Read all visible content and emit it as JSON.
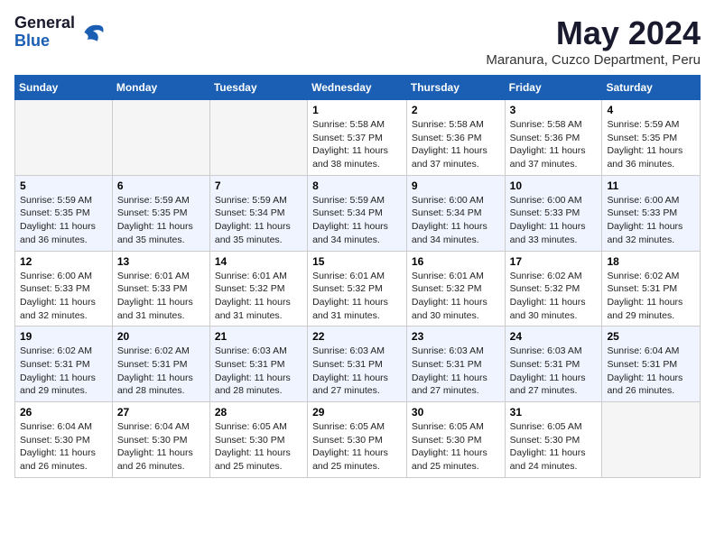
{
  "header": {
    "logo_general": "General",
    "logo_blue": "Blue",
    "main_title": "May 2024",
    "subtitle": "Maranura, Cuzco Department, Peru"
  },
  "days_of_week": [
    "Sunday",
    "Monday",
    "Tuesday",
    "Wednesday",
    "Thursday",
    "Friday",
    "Saturday"
  ],
  "weeks": [
    [
      {
        "day": "",
        "empty": true
      },
      {
        "day": "",
        "empty": true
      },
      {
        "day": "",
        "empty": true
      },
      {
        "day": "1",
        "sunrise": "5:58 AM",
        "sunset": "5:37 PM",
        "daylight": "11 hours and 38 minutes."
      },
      {
        "day": "2",
        "sunrise": "5:58 AM",
        "sunset": "5:36 PM",
        "daylight": "11 hours and 37 minutes."
      },
      {
        "day": "3",
        "sunrise": "5:58 AM",
        "sunset": "5:36 PM",
        "daylight": "11 hours and 37 minutes."
      },
      {
        "day": "4",
        "sunrise": "5:59 AM",
        "sunset": "5:35 PM",
        "daylight": "11 hours and 36 minutes."
      }
    ],
    [
      {
        "day": "5",
        "sunrise": "5:59 AM",
        "sunset": "5:35 PM",
        "daylight": "11 hours and 36 minutes."
      },
      {
        "day": "6",
        "sunrise": "5:59 AM",
        "sunset": "5:35 PM",
        "daylight": "11 hours and 35 minutes."
      },
      {
        "day": "7",
        "sunrise": "5:59 AM",
        "sunset": "5:34 PM",
        "daylight": "11 hours and 35 minutes."
      },
      {
        "day": "8",
        "sunrise": "5:59 AM",
        "sunset": "5:34 PM",
        "daylight": "11 hours and 34 minutes."
      },
      {
        "day": "9",
        "sunrise": "6:00 AM",
        "sunset": "5:34 PM",
        "daylight": "11 hours and 34 minutes."
      },
      {
        "day": "10",
        "sunrise": "6:00 AM",
        "sunset": "5:33 PM",
        "daylight": "11 hours and 33 minutes."
      },
      {
        "day": "11",
        "sunrise": "6:00 AM",
        "sunset": "5:33 PM",
        "daylight": "11 hours and 32 minutes."
      }
    ],
    [
      {
        "day": "12",
        "sunrise": "6:00 AM",
        "sunset": "5:33 PM",
        "daylight": "11 hours and 32 minutes."
      },
      {
        "day": "13",
        "sunrise": "6:01 AM",
        "sunset": "5:33 PM",
        "daylight": "11 hours and 31 minutes."
      },
      {
        "day": "14",
        "sunrise": "6:01 AM",
        "sunset": "5:32 PM",
        "daylight": "11 hours and 31 minutes."
      },
      {
        "day": "15",
        "sunrise": "6:01 AM",
        "sunset": "5:32 PM",
        "daylight": "11 hours and 31 minutes."
      },
      {
        "day": "16",
        "sunrise": "6:01 AM",
        "sunset": "5:32 PM",
        "daylight": "11 hours and 30 minutes."
      },
      {
        "day": "17",
        "sunrise": "6:02 AM",
        "sunset": "5:32 PM",
        "daylight": "11 hours and 30 minutes."
      },
      {
        "day": "18",
        "sunrise": "6:02 AM",
        "sunset": "5:31 PM",
        "daylight": "11 hours and 29 minutes."
      }
    ],
    [
      {
        "day": "19",
        "sunrise": "6:02 AM",
        "sunset": "5:31 PM",
        "daylight": "11 hours and 29 minutes."
      },
      {
        "day": "20",
        "sunrise": "6:02 AM",
        "sunset": "5:31 PM",
        "daylight": "11 hours and 28 minutes."
      },
      {
        "day": "21",
        "sunrise": "6:03 AM",
        "sunset": "5:31 PM",
        "daylight": "11 hours and 28 minutes."
      },
      {
        "day": "22",
        "sunrise": "6:03 AM",
        "sunset": "5:31 PM",
        "daylight": "11 hours and 27 minutes."
      },
      {
        "day": "23",
        "sunrise": "6:03 AM",
        "sunset": "5:31 PM",
        "daylight": "11 hours and 27 minutes."
      },
      {
        "day": "24",
        "sunrise": "6:03 AM",
        "sunset": "5:31 PM",
        "daylight": "11 hours and 27 minutes."
      },
      {
        "day": "25",
        "sunrise": "6:04 AM",
        "sunset": "5:31 PM",
        "daylight": "11 hours and 26 minutes."
      }
    ],
    [
      {
        "day": "26",
        "sunrise": "6:04 AM",
        "sunset": "5:30 PM",
        "daylight": "11 hours and 26 minutes."
      },
      {
        "day": "27",
        "sunrise": "6:04 AM",
        "sunset": "5:30 PM",
        "daylight": "11 hours and 26 minutes."
      },
      {
        "day": "28",
        "sunrise": "6:05 AM",
        "sunset": "5:30 PM",
        "daylight": "11 hours and 25 minutes."
      },
      {
        "day": "29",
        "sunrise": "6:05 AM",
        "sunset": "5:30 PM",
        "daylight": "11 hours and 25 minutes."
      },
      {
        "day": "30",
        "sunrise": "6:05 AM",
        "sunset": "5:30 PM",
        "daylight": "11 hours and 25 minutes."
      },
      {
        "day": "31",
        "sunrise": "6:05 AM",
        "sunset": "5:30 PM",
        "daylight": "11 hours and 24 minutes."
      },
      {
        "day": "",
        "empty": true
      }
    ]
  ]
}
